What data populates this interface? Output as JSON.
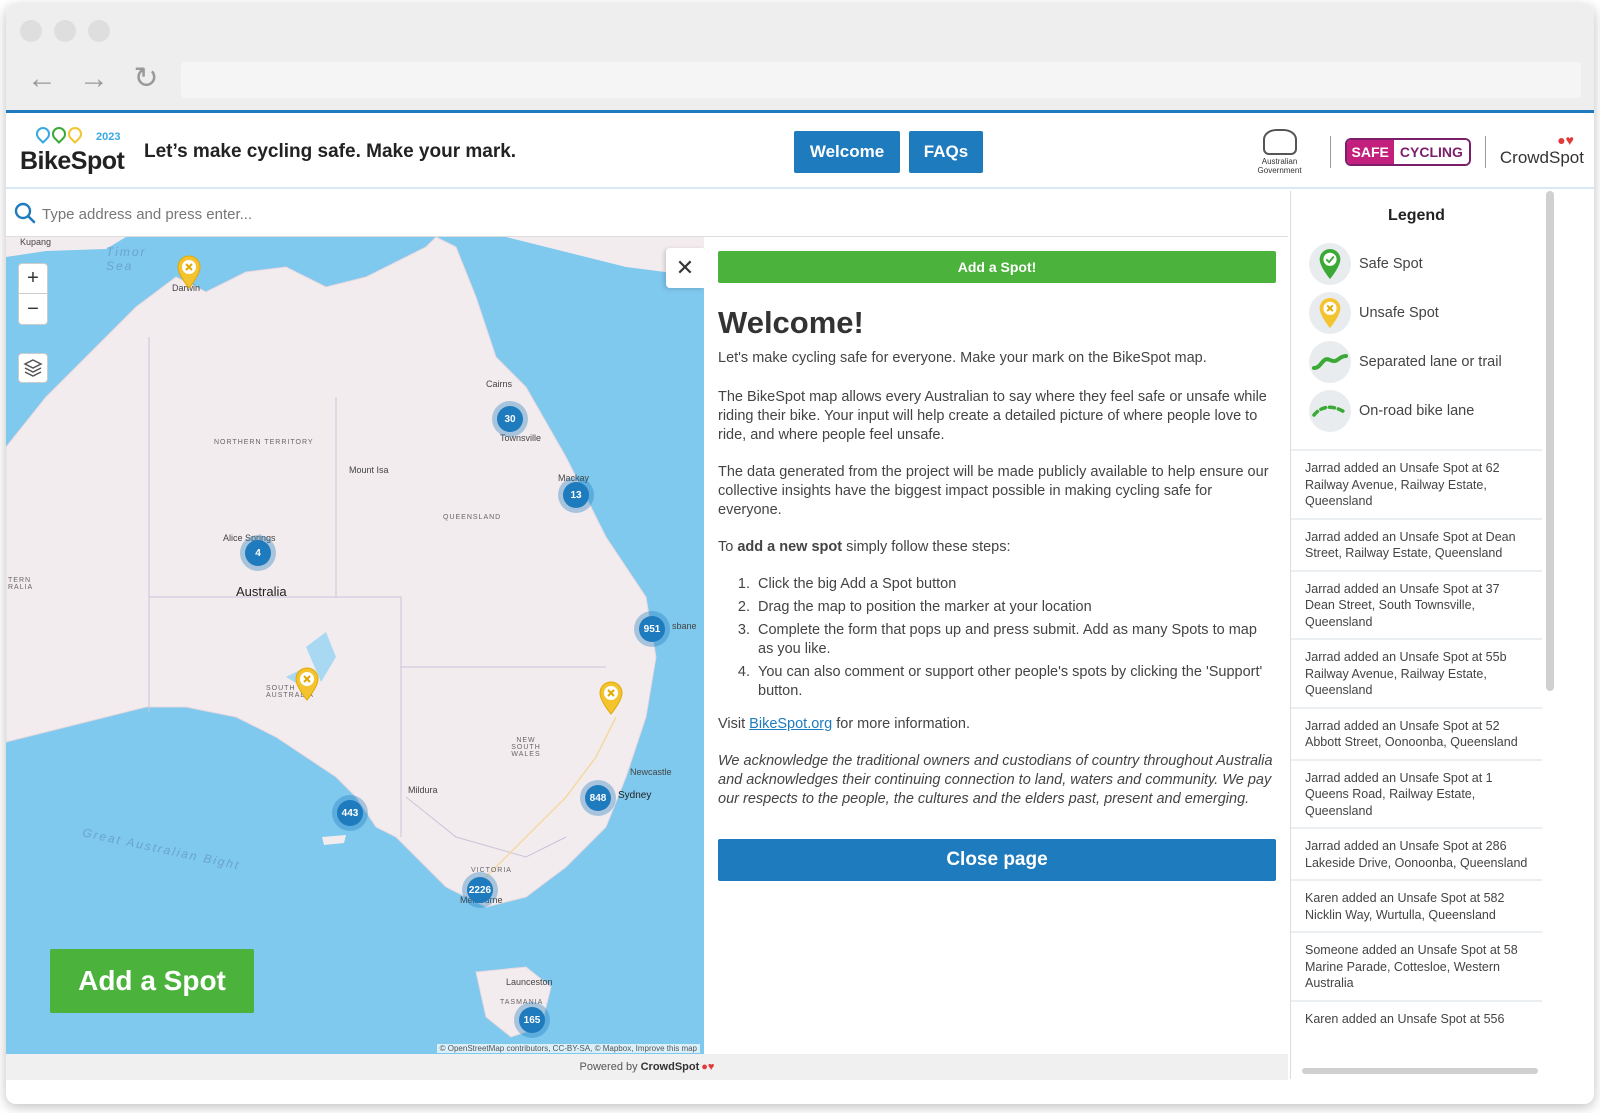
{
  "app": {
    "logo_text": "BikeSpot",
    "logo_year": "2023",
    "tagline": "Let’s make cycling safe. Make your mark.",
    "nav": {
      "welcome": "Welcome",
      "faqs": "FAQs"
    },
    "sponsors": {
      "gov": "Australian Government",
      "safe": "SAFE",
      "cycling": "CYCLING",
      "crowdspot": "CrowdSpot"
    }
  },
  "search": {
    "placeholder": "Type address and press enter..."
  },
  "map": {
    "zoom_in": "+",
    "zoom_out": "−",
    "labels": {
      "australia": "Australia",
      "northern_territory": "NORTHERN TERRITORY",
      "queensland": "QUEENSLAND",
      "south_australia": "SOUTH AUSTRALIA",
      "new_south_wales": "NEW SOUTH WALES",
      "victoria": "VICTORIA",
      "tasmania": "TASMANIA",
      "western_australia": "TERN RALIA",
      "timor_sea": "Timor Sea",
      "great_bight": "Great Australian Bight",
      "cairns": "Cairns",
      "townsville": "Townsville",
      "mackay": "Mackay",
      "mount_isa": "Mount Isa",
      "alice_springs": "Alice Springs",
      "brisbane": "sbane",
      "newcastle": "Newcastle",
      "sydney": "Sydney",
      "mildura": "Mildura",
      "melbourne": "Melbourne",
      "launceston": "Launceston",
      "darwin": "Darwin",
      "kupang": "Kupang"
    },
    "clusters": {
      "townsville": "30",
      "mackay": "13",
      "alice": "4",
      "brisbane": "951",
      "adelaide": "443",
      "sydney": "848",
      "melbourne": "2226",
      "tasmania": "165"
    },
    "add_spot": "Add a Spot",
    "attribution": "© OpenStreetMap contributors, CC-BY-SA, © Mapbox, Improve this map"
  },
  "welcome": {
    "close": "✕",
    "add_spot": "Add a Spot!",
    "title": "Welcome!",
    "intro": "Let's make cycling safe for everyone. Make your mark on the BikeSpot map.",
    "p1": "The BikeSpot map allows every Australian to say where they feel safe or unsafe while riding their bike. Your input will help create a detailed picture of where people love to ride, and where people feel unsafe.",
    "p2": "The data generated from the project will be made publicly available to help ensure our collective insights have the biggest impact possible in making cycling safe for everyone.",
    "steps_pre": "To ",
    "steps_bold": "add a new spot",
    "steps_post": " simply follow these steps:",
    "steps": [
      "Click the big Add a Spot button",
      "Drag the map to position the marker at your location",
      "Complete the form that pops up and press submit. Add as many Spots to map as you like.",
      "You can also comment or support other people's spots by clicking the 'Support' button."
    ],
    "visit_pre": "Visit ",
    "visit_link": "BikeSpot.org",
    "visit_post": " for more information.",
    "ack": "We acknowledge the traditional owners and custodians of country throughout Australia and acknowledges their continuing connection to land, waters and community. We pay our respects to the people, the cultures and the elders past, present and emerging.",
    "close_page": "Close page"
  },
  "legend": {
    "title": "Legend",
    "items": [
      {
        "label": "Safe Spot",
        "icon": "safe-spot-icon"
      },
      {
        "label": "Unsafe Spot",
        "icon": "unsafe-spot-icon"
      },
      {
        "label": "Separated lane or trail",
        "icon": "separated-lane-icon"
      },
      {
        "label": "On-road bike lane",
        "icon": "on-road-lane-icon"
      }
    ],
    "activity": [
      "Jarrad added an Unsafe Spot at 62 Railway Avenue, Railway Estate, Queensland",
      "Jarrad added an Unsafe Spot at Dean Street, Railway Estate, Queensland",
      "Jarrad added an Unsafe Spot at 37 Dean Street, South Townsville, Queensland",
      "Jarrad added an Unsafe Spot at 55b Railway Avenue, Railway Estate, Queensland",
      "Jarrad added an Unsafe Spot at 52 Abbott Street, Oonoonba, Queensland",
      "Jarrad added an Unsafe Spot at 1 Queens Road, Railway Estate, Queensland",
      "Jarrad added an Unsafe Spot at 286 Lakeside Drive, Oonoonba, Queensland",
      "Karen added an Unsafe Spot at 582 Nicklin Way, Wurtulla, Queensland",
      "Someone added an Unsafe Spot at 58 Marine Parade, Cottesloe, Western Australia",
      "Karen added an Unsafe Spot at 556"
    ]
  },
  "footer": {
    "powered": "Powered by",
    "brand": "CrowdSpot"
  },
  "colors": {
    "accent_blue": "#1e7bbd",
    "action_green": "#4bb33c",
    "safe_green": "#3aa935",
    "unsafe_yellow": "#f4c430",
    "ocean": "#7fc8ee",
    "land": "#f3ecef"
  }
}
